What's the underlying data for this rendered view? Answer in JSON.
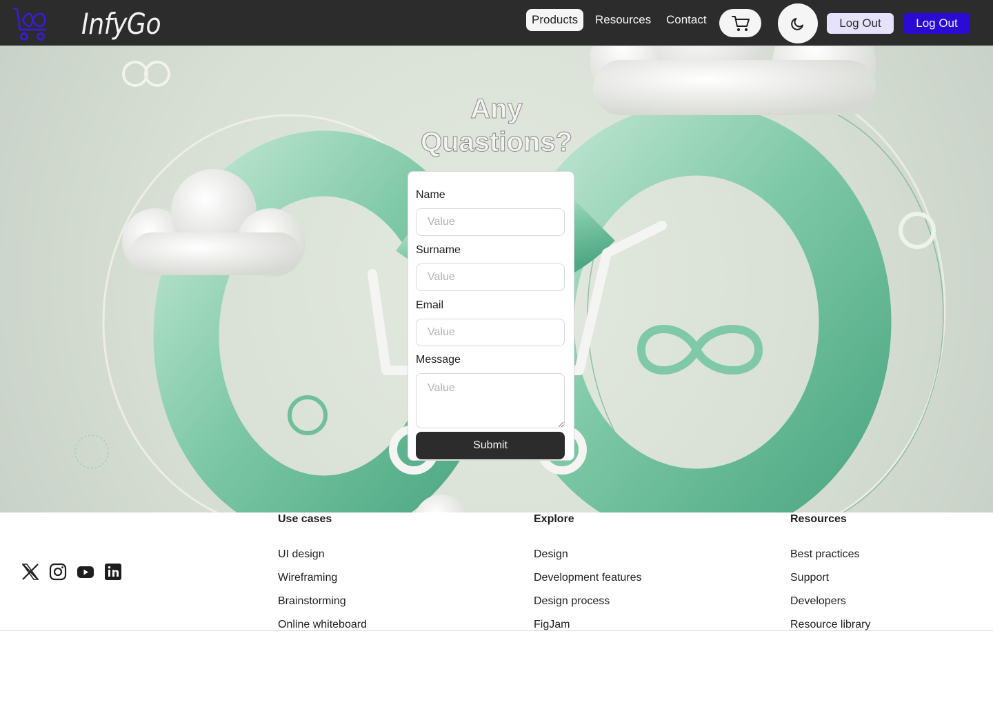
{
  "header": {
    "brand": "InfyGo",
    "nav": [
      {
        "label": "Products",
        "active": true
      },
      {
        "label": "Resources",
        "active": false
      },
      {
        "label": "Contact",
        "active": false
      }
    ],
    "cart_icon": "cart-icon",
    "theme_icon": "moon-icon",
    "logout_secondary": "Log Out",
    "logout_primary": "Log Out",
    "colors": {
      "bar": "#2c2c2c",
      "primary": "#2a0bd6",
      "secondary": "#e6e2fb"
    }
  },
  "hero": {
    "title_line1": "Any",
    "title_line2": "Quastions?",
    "form": {
      "fields": [
        {
          "label": "Name",
          "placeholder": "Value"
        },
        {
          "label": "Surname",
          "placeholder": "Value"
        },
        {
          "label": "Email",
          "placeholder": "Value"
        },
        {
          "label": "Message",
          "placeholder": "Value"
        }
      ],
      "submit": "Submit"
    }
  },
  "footer": {
    "social": [
      "x-icon",
      "instagram-icon",
      "youtube-icon",
      "linkedin-icon"
    ],
    "columns": [
      {
        "title": "Use cases",
        "items": [
          "UI design",
          "Wireframing",
          "Brainstorming",
          "Online whiteboard"
        ]
      },
      {
        "title": "Explore",
        "items": [
          "Design",
          "Development features",
          "Design process",
          "FigJam"
        ]
      },
      {
        "title": "Resources",
        "items": [
          "Best practices",
          "Support",
          "Developers",
          "Resource library"
        ]
      }
    ]
  }
}
